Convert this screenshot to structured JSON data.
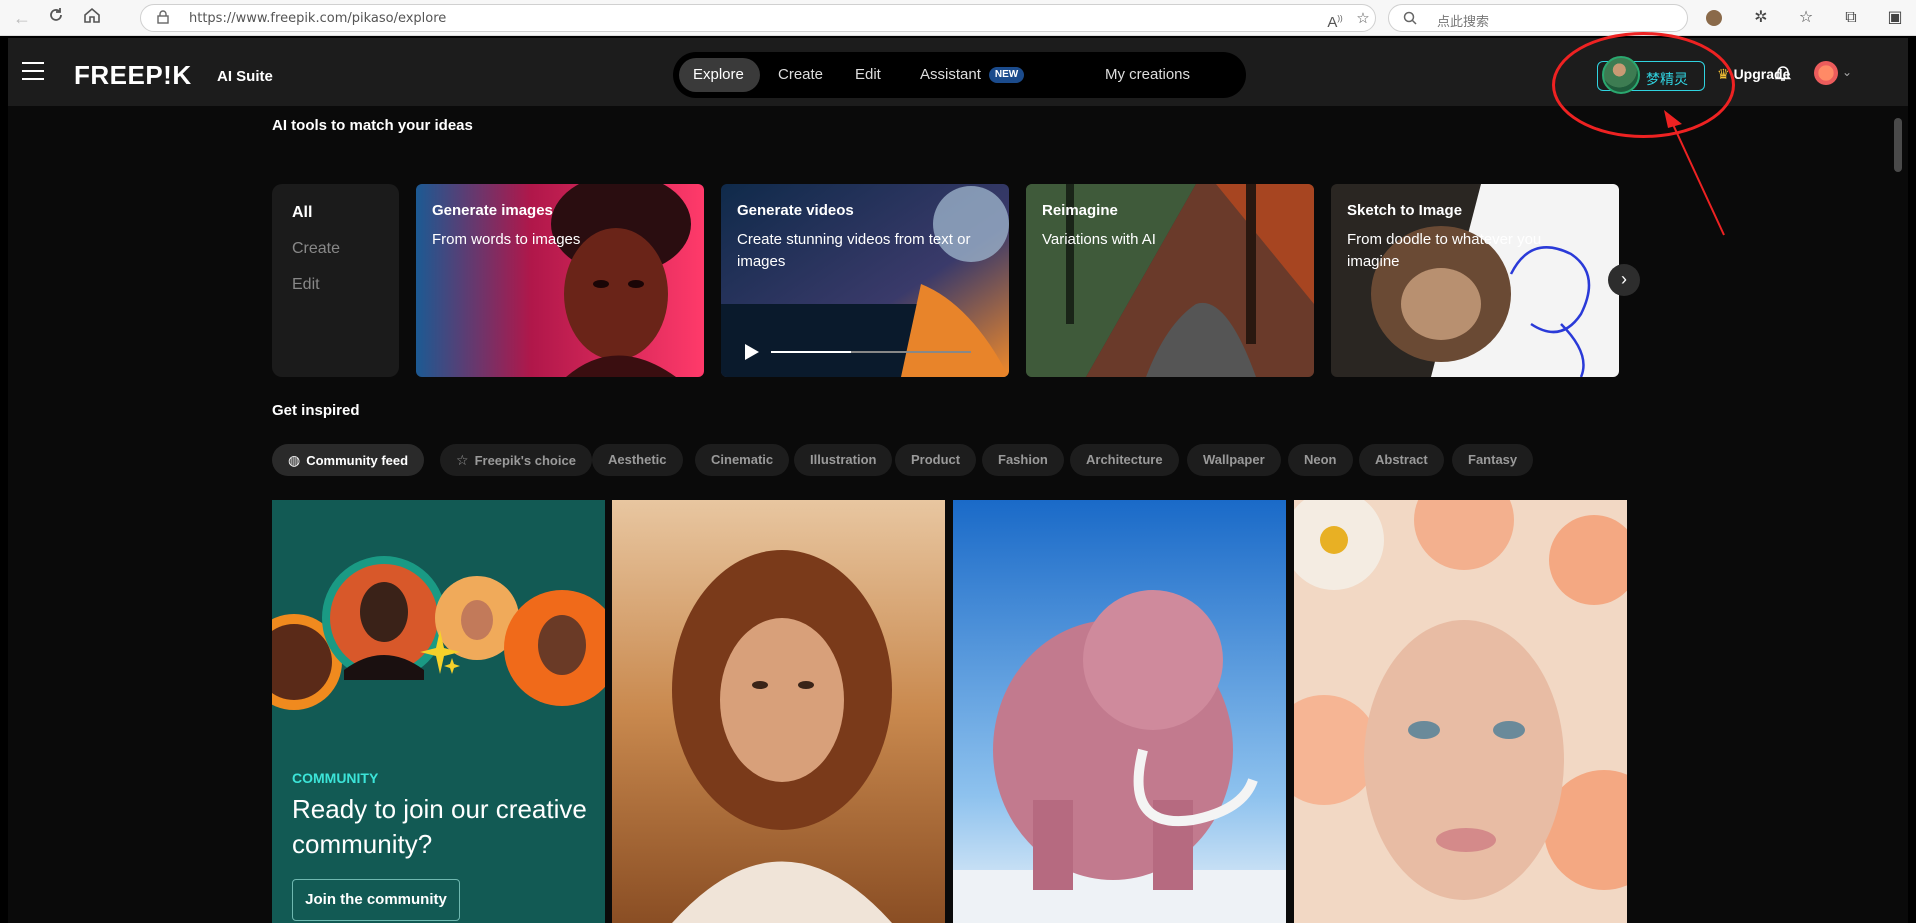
{
  "browser": {
    "url": "https://www.freepik.com/pikaso/explore",
    "search_placeholder": "点此搜索"
  },
  "header": {
    "logo": "FREEP!K",
    "suite": "AI Suite",
    "tabs": [
      {
        "label": "Explore"
      },
      {
        "label": "Create"
      },
      {
        "label": "Edit"
      },
      {
        "label": "Assistant",
        "badge": "NEW"
      },
      {
        "label": "My creations"
      }
    ],
    "profile_name": "梦精灵",
    "upgrade": "Upgrade"
  },
  "tools": {
    "title": "AI tools to match your ideas",
    "filters": [
      "All",
      "Create",
      "Edit"
    ],
    "cards": [
      {
        "title": "Generate images",
        "desc": "From words to images"
      },
      {
        "title": "Generate videos",
        "desc": "Create stunning videos from text or images"
      },
      {
        "title": "Reimagine",
        "desc": "Variations with AI"
      },
      {
        "title": "Sketch to Image",
        "desc": "From doodle to whatever you imagine"
      }
    ]
  },
  "inspired": {
    "title": "Get inspired",
    "chips": [
      "Community feed",
      "Freepik's choice",
      "Aesthetic",
      "Cinematic",
      "Illustration",
      "Product",
      "Fashion",
      "Architecture",
      "Wallpaper",
      "Neon",
      "Abstract",
      "Fantasy"
    ]
  },
  "community": {
    "kicker": "COMMUNITY",
    "headline": "Ready to join our creative community?",
    "button": "Join the community"
  },
  "colors": {
    "accent_cyan": "#30d3e0",
    "community_bg": "#125a54",
    "annotation_red": "#ee2222"
  }
}
